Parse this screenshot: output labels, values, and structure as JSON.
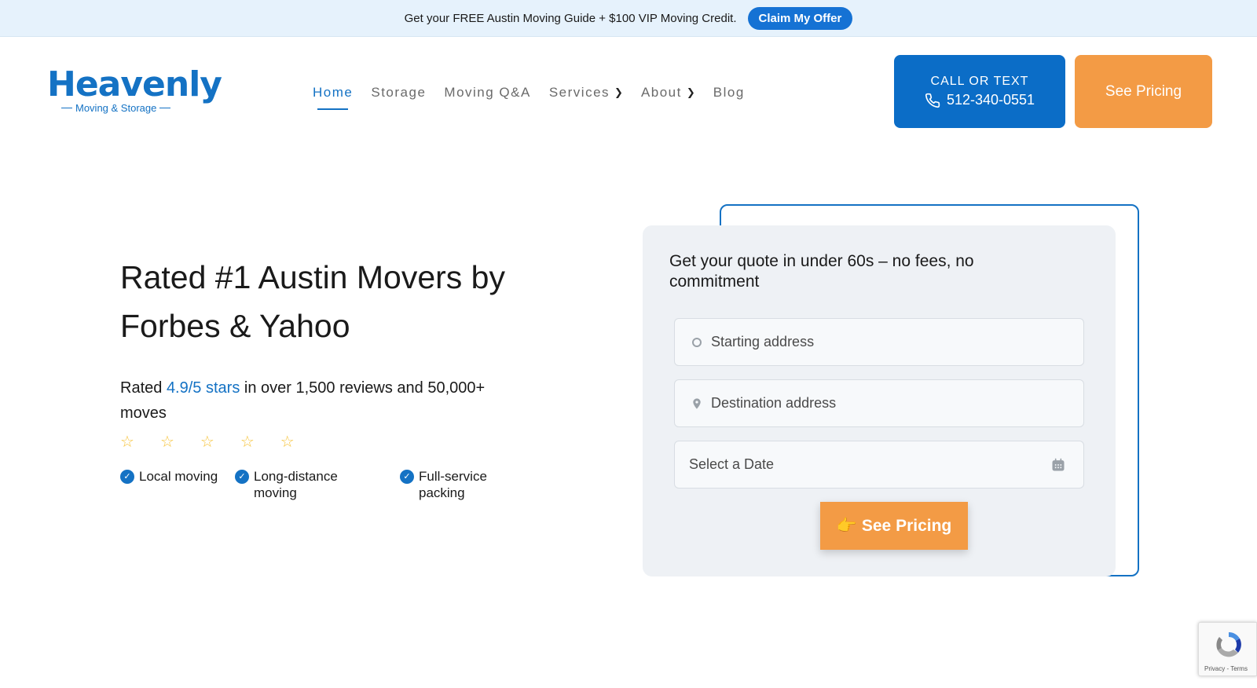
{
  "announcement": {
    "text": "Get your FREE Austin Moving Guide + $100 VIP Moving Credit.",
    "cta": "Claim My Offer"
  },
  "logo": {
    "name": "Heavenly",
    "tagline": "Moving & Storage"
  },
  "nav": {
    "items": [
      {
        "label": "Home",
        "active": true
      },
      {
        "label": "Storage"
      },
      {
        "label": "Moving Q&A"
      },
      {
        "label": "Services",
        "dropdown": true
      },
      {
        "label": "About",
        "dropdown": true
      },
      {
        "label": "Blog"
      }
    ]
  },
  "header": {
    "call_label": "CALL OR TEXT",
    "phone": "512-340-0551",
    "pricing_label": "See Pricing"
  },
  "hero": {
    "title": "Rated #1 Austin Movers by Forbes & Yahoo",
    "rating_prefix": "Rated ",
    "rating_highlight": "4.9/5 stars",
    "rating_suffix": " in over 1,500 reviews and 50,000+ moves",
    "stars": 5,
    "features": [
      "Local moving",
      "Long-distance moving",
      "Full-service packing"
    ]
  },
  "quote": {
    "title": "Get your quote in under 60s – no fees, no commitment",
    "start_placeholder": "Starting address",
    "dest_placeholder": "Destination address",
    "date_placeholder": "Select a Date",
    "submit_label": "See Pricing",
    "submit_emoji": "👉"
  },
  "recaptcha": {
    "links": "Privacy - Terms"
  },
  "colors": {
    "brand_blue": "#1472c4",
    "cta_orange": "#f39b45",
    "announce_bg": "#e6f2fc"
  }
}
